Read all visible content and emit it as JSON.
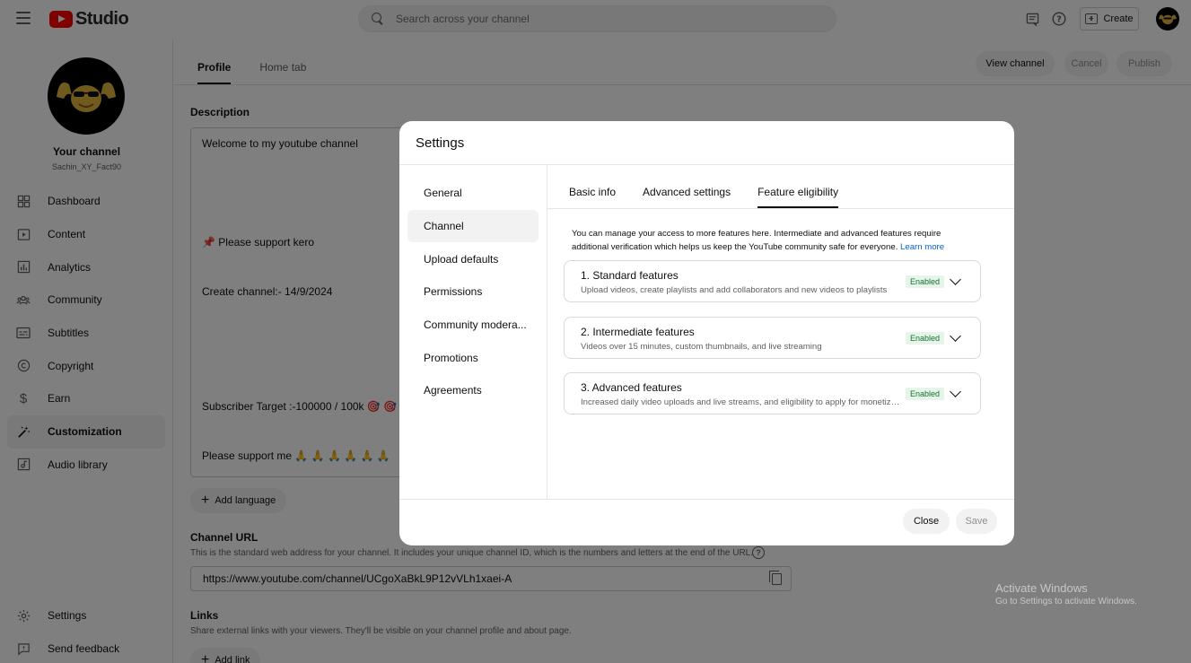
{
  "topbar": {
    "logo_text": "Studio",
    "search_placeholder": "Search across your channel",
    "create_label": "Create"
  },
  "sidebar": {
    "channel_title": "Your channel",
    "channel_handle": "Sachin_XY_Fact90",
    "items": [
      {
        "label": "Dashboard",
        "icon": "dashboard-icon"
      },
      {
        "label": "Content",
        "icon": "content-icon"
      },
      {
        "label": "Analytics",
        "icon": "analytics-icon"
      },
      {
        "label": "Community",
        "icon": "community-icon"
      },
      {
        "label": "Subtitles",
        "icon": "subtitles-icon"
      },
      {
        "label": "Copyright",
        "icon": "copyright-icon"
      },
      {
        "label": "Earn",
        "icon": "earn-icon"
      },
      {
        "label": "Customization",
        "icon": "customization-icon",
        "active": true
      },
      {
        "label": "Audio library",
        "icon": "audio-library-icon"
      }
    ],
    "bottom_items": [
      {
        "label": "Settings",
        "icon": "gear-icon"
      },
      {
        "label": "Send feedback",
        "icon": "feedback-icon"
      }
    ]
  },
  "main": {
    "tabs": [
      {
        "label": "Profile"
      },
      {
        "label": "Home tab"
      }
    ],
    "view_channel_label": "View channel",
    "cancel_label": "Cancel",
    "publish_label": "Publish",
    "description_label": "Description",
    "description_lines": [
      "Welcome to my youtube channel",
      "📌 Please support kero",
      "Create channel:- 14/9/2024",
      "Subscriber Target :-100000 / 100k 🎯 🎯 🎯",
      "Please support me 🙏 🙏 🙏 🙏 🙏 🙏"
    ],
    "add_language_label": "Add language",
    "channel_url_label": "Channel URL",
    "channel_url_help": "This is the standard web address for your channel. It includes your unique channel ID, which is the numbers and letters at the end of the URL.",
    "channel_url_value": "https://www.youtube.com/channel/UCgoXaBkL9P12vVLh1xaei-A",
    "links_label": "Links",
    "links_help": "Share external links with your viewers. They'll be visible on your channel profile and about page.",
    "add_link_label": "Add link"
  },
  "watermark": {
    "line1": "Activate Windows",
    "line2": "Go to Settings to activate Windows."
  },
  "dialog": {
    "title": "Settings",
    "nav": [
      {
        "label": "General"
      },
      {
        "label": "Channel",
        "active": true
      },
      {
        "label": "Upload defaults"
      },
      {
        "label": "Permissions"
      },
      {
        "label": "Community modera..."
      },
      {
        "label": "Promotions"
      },
      {
        "label": "Agreements"
      }
    ],
    "tabs": [
      {
        "label": "Basic info"
      },
      {
        "label": "Advanced settings"
      },
      {
        "label": "Feature eligibility",
        "active": true
      }
    ],
    "intro_text": "You can manage your access to more features here. Intermediate and advanced features require additional verification which helps us keep the YouTube community safe for everyone.",
    "learn_more": "Learn more",
    "features": [
      {
        "title": "1. Standard features",
        "subtitle": "Upload videos, create playlists and add collaborators and new videos to playlists",
        "status": "Enabled"
      },
      {
        "title": "2. Intermediate features",
        "subtitle": "Videos over 15 minutes, custom thumbnails, and live streaming",
        "status": "Enabled"
      },
      {
        "title": "3. Advanced features",
        "subtitle": "Increased daily video uploads and live streams, and eligibility to apply for monetization",
        "status": "Enabled"
      }
    ],
    "close_label": "Close",
    "save_label": "Save"
  },
  "colors": {
    "accent_red": "#ff0000",
    "link_blue": "#065fd4",
    "enabled_bg": "#e6f4ea",
    "enabled_text": "#137333"
  }
}
